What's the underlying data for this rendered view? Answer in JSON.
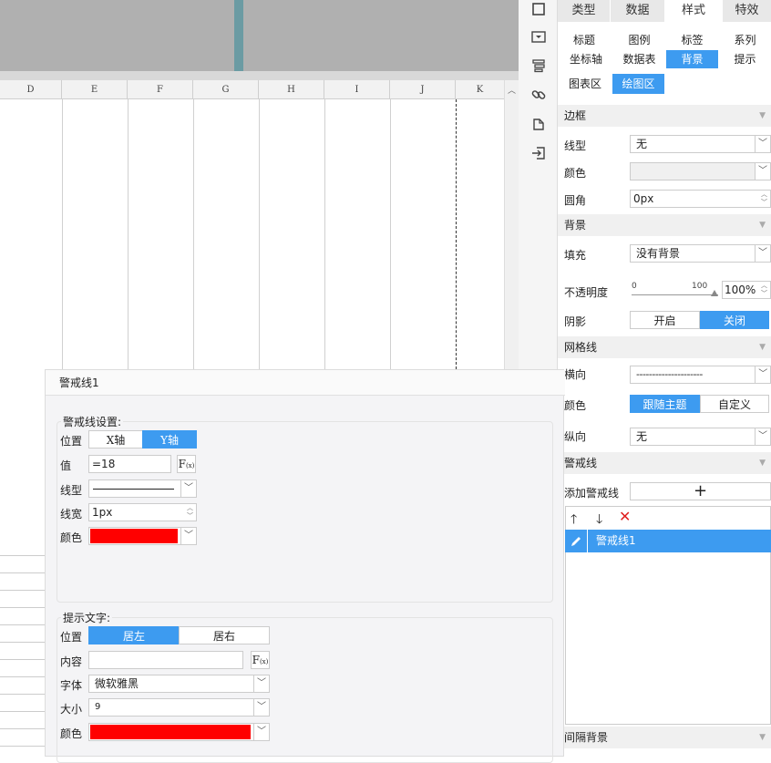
{
  "sheet": {
    "columns": [
      "D",
      "E",
      "F",
      "G",
      "H",
      "I",
      "J",
      "K"
    ]
  },
  "sidebar_icons": [
    "square-icon",
    "dropdown-icon",
    "stack-icon",
    "link-icon",
    "rotate-icon",
    "import-icon"
  ],
  "panel": {
    "main_tabs": [
      "类型",
      "数据",
      "样式",
      "特效"
    ],
    "sub_tabs_row1": [
      "标题",
      "图例",
      "标签",
      "系列"
    ],
    "sub_tabs_row2": [
      "坐标轴",
      "数据表",
      "背景",
      "提示"
    ],
    "sub_tabs_row3": [
      "图表区",
      "绘图区"
    ],
    "border": {
      "section": "边框",
      "linetype_label": "线型",
      "linetype_value": "无",
      "color_label": "颜色",
      "radius_label": "圆角",
      "radius_value": "0px"
    },
    "background": {
      "section": "背景",
      "fill_label": "填充",
      "fill_value": "没有背景",
      "opacity_label": "不透明度",
      "slider_min": "0",
      "slider_max": "100",
      "opacity_value": "100%",
      "opacity_level": 100,
      "shadow_label": "阴影",
      "shadow_on": "开启",
      "shadow_off": "关闭"
    },
    "grid": {
      "section": "网格线",
      "horizontal_label": "横向",
      "horizontal_value": "---------------------",
      "color_label": "颜色",
      "color_theme": "跟随主题",
      "color_custom": "自定义",
      "vertical_label": "纵向",
      "vertical_value": "无"
    },
    "alert": {
      "section": "警戒线",
      "add_label": "添加警戒线",
      "add_symbol": "+",
      "item": "警戒线1"
    },
    "interval": {
      "section": "间隔背景"
    }
  },
  "dialog": {
    "title": "警戒线1",
    "settings": {
      "group": "警戒线设置:",
      "position_label": "位置",
      "x_axis": "X轴",
      "y_axis": "Y轴",
      "value_label": "值",
      "value": "=18",
      "fx": "F",
      "fx_sub": "(x)",
      "linetype_label": "线型",
      "linewidth_label": "线宽",
      "linewidth_value": "1px",
      "color_label": "颜色",
      "color": "#ff0000"
    },
    "tip": {
      "group": "提示文字:",
      "position_label": "位置",
      "left": "居左",
      "right": "居右",
      "content_label": "内容",
      "content_value": "",
      "font_label": "字体",
      "font_value": "微软雅黑",
      "size_label": "大小",
      "size_value": "9",
      "color_label": "颜色",
      "color": "#ff0000"
    }
  },
  "colors": {
    "accent": "#3d9bf0",
    "alert_red": "#ff0000",
    "delete_red": "#e02020"
  }
}
